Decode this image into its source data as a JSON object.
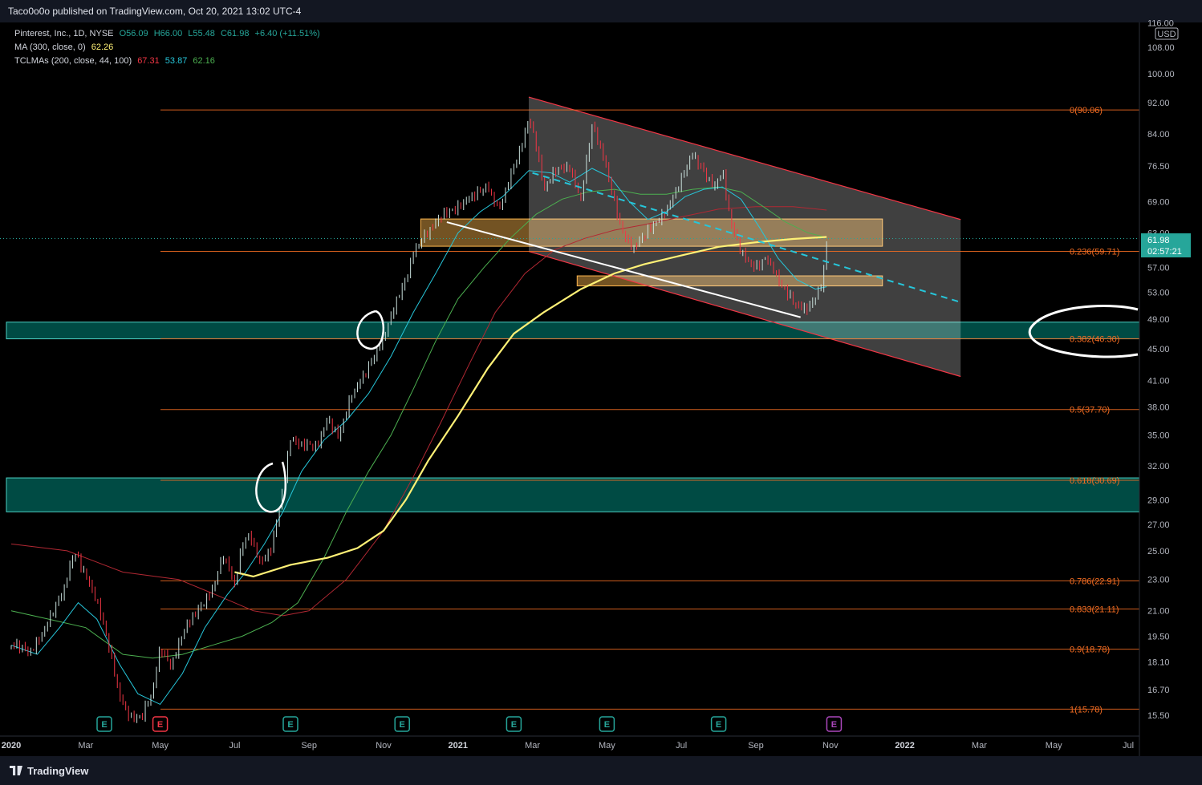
{
  "header": {
    "publisher": "Taco0o0o published on TradingView.com, Oct 20, 2021 13:02 UTC-4"
  },
  "legend": {
    "symbol": "Pinterest, Inc., 1D, NYSE",
    "open": "O56.09",
    "high": "H66.00",
    "low": "L55.48",
    "close": "C61.98",
    "change": "+6.40 (+11.51%)",
    "ma_label": "MA (300, close, 0)",
    "ma_value": "62.26",
    "tcl_label": "TCLMAs (200, close, 44, 100)",
    "tcl_v1": "67.31",
    "tcl_v2": "53.87",
    "tcl_v3": "62.16"
  },
  "price_axis": {
    "currency": "USD",
    "ticks": [
      "116.00",
      "108.00",
      "100.00",
      "92.00",
      "84.00",
      "76.50",
      "69.00",
      "63.00",
      "57.00",
      "53.00",
      "49.00",
      "45.00",
      "41.00",
      "38.00",
      "35.00",
      "32.00",
      "29.00",
      "27.00",
      "25.00",
      "23.00",
      "21.00",
      "19.50",
      "18.10",
      "16.70",
      "15.50"
    ],
    "last_price": "61.98",
    "countdown": "02:57:21"
  },
  "time_axis": {
    "labels": [
      "2020",
      "Mar",
      "May",
      "Jul",
      "Sep",
      "Nov",
      "2021",
      "Mar",
      "May",
      "Jul",
      "Sep",
      "Nov",
      "2022",
      "Mar",
      "May",
      "Jul"
    ]
  },
  "footer": {
    "brand": "TradingView"
  },
  "colors": {
    "fib": "#f46d22",
    "teal_zone": "#00897b",
    "orange_zone": "#ffb74d",
    "channel": "#f23645",
    "ma300": "#fff176",
    "tcl_red": "#b22833",
    "tcl_cyan": "#26c6da",
    "tcl_green": "#4caf50",
    "trend_dash": "#26c6da",
    "earnings": "#26a69a",
    "earnings_red": "#f23645",
    "earnings_future": "#ab47bc"
  },
  "chart_data": {
    "type": "candlestick",
    "title": "Pinterest, Inc., 1D, NYSE",
    "scale": "log",
    "ylim": [
      15.0,
      116.0
    ],
    "x_range": [
      "2020-01",
      "2022-07"
    ],
    "fib_levels": [
      {
        "label": "0(90.06)",
        "value": 90.06
      },
      {
        "label": "0.236(59.71)",
        "value": 59.71
      },
      {
        "label": "0.382(46.30)",
        "value": 46.3
      },
      {
        "label": "0.5(37.70)",
        "value": 37.7
      },
      {
        "label": "0.618(30.69)",
        "value": 30.69
      },
      {
        "label": "0.786(22.91)",
        "value": 22.91
      },
      {
        "label": "0.833(21.11)",
        "value": 21.11
      },
      {
        "label": "0.9(18.78)",
        "value": 18.78
      },
      {
        "label": "1(15.78)",
        "value": 15.78
      }
    ],
    "zones": [
      {
        "kind": "teal",
        "from": 46.3,
        "to": 48.6
      },
      {
        "kind": "teal",
        "from": 28.0,
        "to": 30.9
      },
      {
        "kind": "orange",
        "from": 60.6,
        "to": 65.6
      },
      {
        "kind": "orange",
        "from": 54.0,
        "to": 55.6
      }
    ],
    "earnings": [
      {
        "label": "E",
        "month": 2.5,
        "kind": "normal"
      },
      {
        "label": "E",
        "month": 4.0,
        "kind": "red"
      },
      {
        "label": "E",
        "month": 7.5,
        "kind": "normal"
      },
      {
        "label": "E",
        "month": 10.5,
        "kind": "normal"
      },
      {
        "label": "E",
        "month": 13.5,
        "kind": "normal"
      },
      {
        "label": "E",
        "month": 16.0,
        "kind": "normal"
      },
      {
        "label": "E",
        "month": 19.0,
        "kind": "normal"
      },
      {
        "label": "E",
        "month": 22.1,
        "kind": "future"
      }
    ],
    "price_path": [
      [
        0.0,
        19.0
      ],
      [
        0.5,
        18.5
      ],
      [
        1.0,
        20.5
      ],
      [
        1.4,
        22.0
      ],
      [
        1.7,
        25.0
      ],
      [
        2.0,
        23.5
      ],
      [
        2.3,
        21.5
      ],
      [
        2.6,
        19.0
      ],
      [
        2.9,
        16.5
      ],
      [
        3.2,
        15.5
      ],
      [
        3.5,
        15.3
      ],
      [
        3.8,
        16.5
      ],
      [
        4.0,
        19.0
      ],
      [
        4.3,
        18.0
      ],
      [
        4.6,
        19.5
      ],
      [
        5.0,
        21.0
      ],
      [
        5.4,
        22.5
      ],
      [
        5.7,
        24.5
      ],
      [
        6.0,
        22.5
      ],
      [
        6.2,
        25.5
      ],
      [
        6.4,
        26.5
      ],
      [
        6.7,
        24.0
      ],
      [
        7.0,
        25.0
      ],
      [
        7.3,
        30.0
      ],
      [
        7.5,
        35.0
      ],
      [
        7.8,
        34.0
      ],
      [
        8.2,
        33.5
      ],
      [
        8.5,
        37.0
      ],
      [
        8.8,
        35.0
      ],
      [
        9.1,
        38.5
      ],
      [
        9.4,
        41.0
      ],
      [
        9.7,
        44.0
      ],
      [
        10.0,
        46.5
      ],
      [
        10.2,
        49.0
      ],
      [
        10.4,
        52.0
      ],
      [
        10.6,
        55.0
      ],
      [
        10.8,
        60.0
      ],
      [
        11.0,
        62.0
      ],
      [
        11.3,
        63.5
      ],
      [
        11.7,
        67.0
      ],
      [
        12.1,
        69.0
      ],
      [
        12.5,
        70.0
      ],
      [
        12.8,
        72.0
      ],
      [
        13.1,
        68.0
      ],
      [
        13.4,
        74.0
      ],
      [
        13.7,
        80.0
      ],
      [
        13.9,
        88.0
      ],
      [
        14.1,
        82.0
      ],
      [
        14.3,
        72.0
      ],
      [
        14.6,
        75.0
      ],
      [
        15.0,
        76.0
      ],
      [
        15.3,
        70.0
      ],
      [
        15.6,
        86.0
      ],
      [
        15.9,
        78.0
      ],
      [
        16.2,
        69.0
      ],
      [
        16.4,
        64.0
      ],
      [
        16.7,
        60.0
      ],
      [
        17.0,
        62.0
      ],
      [
        17.3,
        65.0
      ],
      [
        17.7,
        69.0
      ],
      [
        18.0,
        73.0
      ],
      [
        18.3,
        79.0
      ],
      [
        18.6,
        76.0
      ],
      [
        18.9,
        72.0
      ],
      [
        19.1,
        75.0
      ],
      [
        19.3,
        65.0
      ],
      [
        19.6,
        60.0
      ],
      [
        20.0,
        57.0
      ],
      [
        20.3,
        58.0
      ],
      [
        20.6,
        55.0
      ],
      [
        20.9,
        53.0
      ],
      [
        21.1,
        51.0
      ],
      [
        21.4,
        50.0
      ],
      [
        21.6,
        52.0
      ],
      [
        21.8,
        55.0
      ],
      [
        21.9,
        61.98
      ]
    ],
    "ma300_path": [
      [
        6.0,
        23.5
      ],
      [
        6.5,
        23.2
      ],
      [
        7.5,
        24.0
      ],
      [
        8.5,
        24.5
      ],
      [
        9.3,
        25.2
      ],
      [
        10.0,
        26.5
      ],
      [
        10.6,
        29.0
      ],
      [
        11.2,
        32.5
      ],
      [
        12.0,
        37.0
      ],
      [
        12.8,
        42.5
      ],
      [
        13.5,
        47.0
      ],
      [
        14.3,
        50.0
      ],
      [
        15.3,
        53.5
      ],
      [
        16.2,
        56.0
      ],
      [
        17.0,
        57.5
      ],
      [
        18.0,
        59.0
      ],
      [
        19.0,
        60.5
      ],
      [
        20.0,
        61.3
      ],
      [
        21.0,
        61.9
      ],
      [
        21.9,
        62.26
      ]
    ],
    "tcl_red_path": [
      [
        0.0,
        25.5
      ],
      [
        1.5,
        25.0
      ],
      [
        3.0,
        23.5
      ],
      [
        4.5,
        23.0
      ],
      [
        5.5,
        22.0
      ],
      [
        6.5,
        21.0
      ],
      [
        7.3,
        20.7
      ],
      [
        8.0,
        21.0
      ],
      [
        9.0,
        23.0
      ],
      [
        10.0,
        26.5
      ],
      [
        10.8,
        31.0
      ],
      [
        11.5,
        36.0
      ],
      [
        12.3,
        43.0
      ],
      [
        13.0,
        50.0
      ],
      [
        13.8,
        56.0
      ],
      [
        14.6,
        60.0
      ],
      [
        15.4,
        62.0
      ],
      [
        16.2,
        63.5
      ],
      [
        17.0,
        64.5
      ],
      [
        18.0,
        66.0
      ],
      [
        19.0,
        67.5
      ],
      [
        20.0,
        68.0
      ],
      [
        21.0,
        68.0
      ],
      [
        21.9,
        67.31
      ]
    ],
    "tcl_cyan_path": [
      [
        0.0,
        19.0
      ],
      [
        0.7,
        18.5
      ],
      [
        1.3,
        20.0
      ],
      [
        1.8,
        21.5
      ],
      [
        2.3,
        20.5
      ],
      [
        2.9,
        18.0
      ],
      [
        3.4,
        16.5
      ],
      [
        4.0,
        16.0
      ],
      [
        4.6,
        17.5
      ],
      [
        5.2,
        20.0
      ],
      [
        5.8,
        22.0
      ],
      [
        6.3,
        23.5
      ],
      [
        6.8,
        25.5
      ],
      [
        7.3,
        28.0
      ],
      [
        7.8,
        31.5
      ],
      [
        8.4,
        34.5
      ],
      [
        9.0,
        36.5
      ],
      [
        9.6,
        39.5
      ],
      [
        10.2,
        44.0
      ],
      [
        10.8,
        50.0
      ],
      [
        11.4,
        56.0
      ],
      [
        12.0,
        63.0
      ],
      [
        12.6,
        67.0
      ],
      [
        13.2,
        70.0
      ],
      [
        13.9,
        75.5
      ],
      [
        14.5,
        75.0
      ],
      [
        15.0,
        73.0
      ],
      [
        15.6,
        76.0
      ],
      [
        16.1,
        74.0
      ],
      [
        16.6,
        69.0
      ],
      [
        17.1,
        65.5
      ],
      [
        17.6,
        67.0
      ],
      [
        18.1,
        70.0
      ],
      [
        18.6,
        71.5
      ],
      [
        19.1,
        72.0
      ],
      [
        19.6,
        69.5
      ],
      [
        20.1,
        64.0
      ],
      [
        20.6,
        58.5
      ],
      [
        21.1,
        55.0
      ],
      [
        21.6,
        53.5
      ],
      [
        21.9,
        53.87
      ]
    ],
    "tcl_green_path": [
      [
        0.0,
        21.0
      ],
      [
        1.0,
        20.5
      ],
      [
        2.0,
        20.0
      ],
      [
        3.0,
        18.5
      ],
      [
        3.8,
        18.3
      ],
      [
        4.6,
        18.5
      ],
      [
        5.4,
        19.0
      ],
      [
        6.2,
        19.5
      ],
      [
        7.0,
        20.3
      ],
      [
        7.7,
        21.5
      ],
      [
        8.4,
        24.5
      ],
      [
        9.0,
        28.0
      ],
      [
        9.6,
        31.5
      ],
      [
        10.2,
        35.0
      ],
      [
        10.8,
        40.0
      ],
      [
        11.4,
        46.0
      ],
      [
        12.0,
        52.0
      ],
      [
        12.7,
        57.0
      ],
      [
        13.4,
        62.0
      ],
      [
        14.1,
        66.5
      ],
      [
        14.8,
        69.5
      ],
      [
        15.5,
        71.0
      ],
      [
        16.2,
        71.5
      ],
      [
        16.9,
        70.5
      ],
      [
        17.6,
        70.5
      ],
      [
        18.3,
        71.5
      ],
      [
        19.0,
        72.0
      ],
      [
        19.6,
        71.0
      ],
      [
        20.2,
        68.0
      ],
      [
        20.8,
        65.0
      ],
      [
        21.4,
        63.0
      ],
      [
        21.9,
        62.16
      ]
    ],
    "channel": {
      "upper": [
        [
          13.9,
          93.5
        ],
        [
          25.5,
          65.5
        ]
      ],
      "lower": [
        [
          13.9,
          59.7
        ],
        [
          25.5,
          41.5
        ]
      ],
      "right_edge_month": 25.5
    },
    "trendlines": [
      {
        "kind": "white",
        "from": [
          11.7,
          65.0
        ],
        "to": [
          21.2,
          49.3
        ]
      },
      {
        "kind": "dashed",
        "from": [
          14.0,
          75.0
        ],
        "to": [
          25.5,
          51.5
        ]
      }
    ]
  }
}
